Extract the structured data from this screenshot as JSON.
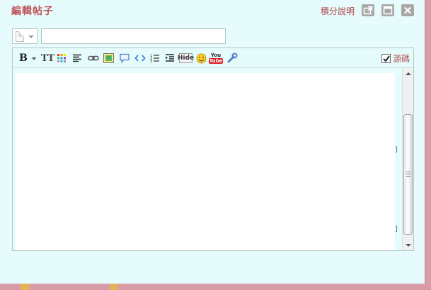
{
  "dialog": {
    "title": "編輯帖子",
    "credit_link": "積分說明",
    "buttons": [
      "popout-icon",
      "maximize-icon",
      "close-icon"
    ]
  },
  "subject": {
    "value": "",
    "doc_type_icon": "document-icon"
  },
  "toolbar": {
    "bold": "B",
    "font_size": "TT",
    "hide": "Hide",
    "youtube_top": "You",
    "youtube_bottom": "Tube",
    "icons": [
      "bold-icon",
      "font-size-icon",
      "color-icon",
      "align-icon",
      "link-icon",
      "image-icon",
      "quote-icon",
      "code-icon",
      "ordered-list-icon",
      "indent-icon",
      "hide-icon",
      "smiley-icon",
      "youtube-icon",
      "tools-icon"
    ],
    "source_label": "源碼",
    "source_checked": true
  },
  "editor": {
    "content": ""
  },
  "colors": {
    "title": "#c0545a",
    "link": "#b04848",
    "dialog_bg": "#e6fcfc",
    "frame": "#d89ca6"
  }
}
